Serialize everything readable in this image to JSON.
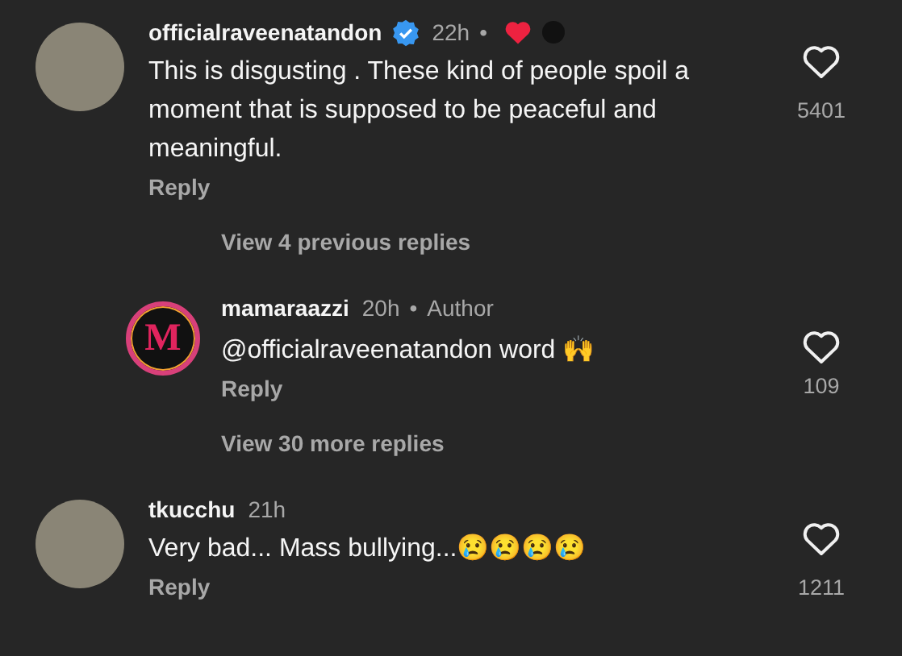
{
  "items": [
    {
      "kind": "comment",
      "username": "officialraveenatandon",
      "verified": true,
      "time": "22h",
      "separator": "•",
      "author_liked": true,
      "story_ring": false,
      "text": "This is disgusting . These kind of people spoil a moment that is supposed to be peaceful and meaningful.",
      "reply": "Reply",
      "likes": "5401"
    },
    {
      "kind": "more",
      "text": "View 4 previous replies"
    },
    {
      "kind": "reply",
      "username": "mamaraazzi",
      "verified": false,
      "time": "20h",
      "separator": "•",
      "author_liked": false,
      "author_label": "Author",
      "story_ring": true,
      "avatar_text": "M",
      "text": "@officialraveenatandon word 🙌",
      "reply": "Reply",
      "likes": "109"
    },
    {
      "kind": "more",
      "text": "View 30 more replies"
    },
    {
      "kind": "comment",
      "username": "tkucchu",
      "verified": false,
      "time": "21h",
      "author_liked": false,
      "story_ring": false,
      "text": "Very bad... Mass bullying...😢😢😢😢",
      "reply": "Reply",
      "likes": "1211"
    }
  ]
}
